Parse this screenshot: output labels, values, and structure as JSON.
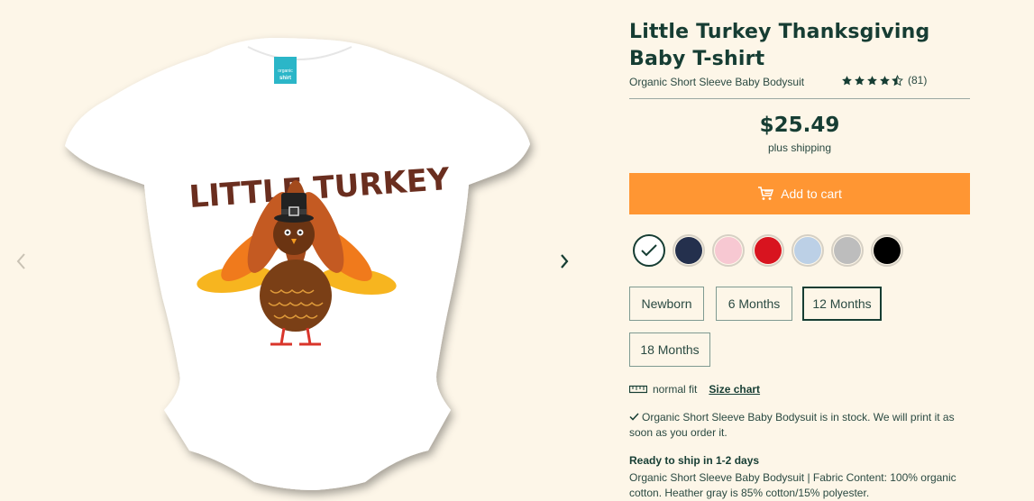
{
  "product": {
    "title": "Little Turkey Thanksgiving Baby T-shirt",
    "subtitle": "Organic Short Sleeve Baby Bodysuit",
    "rating_count": "(81)",
    "rating_value": 4.5,
    "price": "$25.49",
    "shipping_note": "plus shipping"
  },
  "image": {
    "tag_text_top": "organic",
    "tag_text_bottom": "shirt",
    "print_text": "LITTLE TURKEY"
  },
  "actions": {
    "add_to_cart": "Add to cart"
  },
  "colors": [
    {
      "name": "white",
      "hex": "#ffffff"
    },
    {
      "name": "navy",
      "hex": "#24304d"
    },
    {
      "name": "pink",
      "hex": "#f7c8d2"
    },
    {
      "name": "red",
      "hex": "#d8141f"
    },
    {
      "name": "light-blue",
      "hex": "#bcd0e6"
    },
    {
      "name": "gray",
      "hex": "#bdbdbd"
    },
    {
      "name": "black",
      "hex": "#000000"
    }
  ],
  "sizes": [
    {
      "label": "Newborn",
      "selected": false
    },
    {
      "label": "6 Months",
      "selected": false
    },
    {
      "label": "12 Months",
      "selected": true
    },
    {
      "label": "18 Months",
      "selected": false
    }
  ],
  "fit": {
    "label": "normal fit",
    "size_chart": "Size chart"
  },
  "stock": {
    "text": "Organic Short Sleeve Baby Bodysuit is in stock. We will print it as soon as you order it."
  },
  "shipping": {
    "heading": "Ready to ship in 1-2 days",
    "description": "Organic Short Sleeve Baby Bodysuit | Fabric Content: 100% organic cotton. Heather gray is 85% cotton/15% polyester."
  },
  "theme": {
    "background": "#fdf6e8",
    "accent": "#ff9633",
    "text": "#163d33"
  }
}
